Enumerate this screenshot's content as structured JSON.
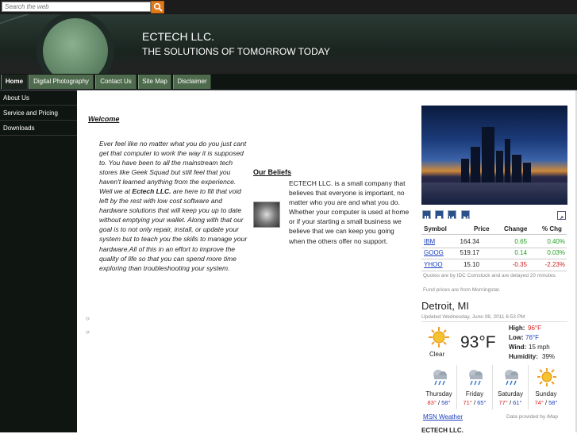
{
  "search": {
    "placeholder": "Search the web"
  },
  "header": {
    "title": "ECTECH LLC.",
    "tagline": "THE SOLUTIONS OF TOMORROW TODAY"
  },
  "nav": {
    "items": [
      "Home",
      "Digital Photography",
      "Contact Us",
      "Site Map",
      "Disclaimer"
    ]
  },
  "sidebar": {
    "items": [
      "About Us",
      "Service and Pricing",
      "Downloads"
    ]
  },
  "welcome": {
    "heading": "Welcome",
    "text_before": "Ever feel like no matter what you do you just cant get that computer to work the way it is supposed to.  You have been to all the mainstream tech stores like Geek Squad but still feel that you haven't learned anything from the experience.  Well we at ",
    "brand": "Ectech LLC.",
    "text_after": " are here to fill that void left by the rest with low cost software and hardware solutions that will keep you up to date without emptying your wallet. Along with that our goal is to not only repair, install, or update your system but to teach you the skills to manage your hardware.All of this in an effort to improve the quality of life so that you can spend more time exploring than troubleshooting your system."
  },
  "beliefs": {
    "heading": "Our Beliefs",
    "text": "ECTECH LLC. is a small company that believes that everyone is important, no matter who you are and what you do.  Whether your computer is used at home or if your starting a small business we believe that we can keep you going when the others offer no support."
  },
  "stocks": {
    "headers": {
      "symbol": "Symbol",
      "price": "Price",
      "change": "Change",
      "pct": "% Chg"
    },
    "rows": [
      {
        "symbol": "IBM",
        "price": "164.34",
        "change": "0.65",
        "pct": "0.40%",
        "dir": "up"
      },
      {
        "symbol": "GOOG",
        "price": "519.17",
        "change": "0.14",
        "pct": "0.03%",
        "dir": "up"
      },
      {
        "symbol": "YHOO",
        "price": "15.10",
        "change": "-0.35",
        "pct": "-2.23%",
        "dir": "down"
      }
    ],
    "note1": "Quotes are by IDC Comstock and are delayed 20 minutes.",
    "note2": "Fund prices are from Morningstar."
  },
  "weather": {
    "city": "Detroit, MI",
    "updated": "Updated Wednesday, June 08, 2011 6:53 PM",
    "condition": "Clear",
    "temp": "93°F",
    "high_label": "High:",
    "high": "96°F",
    "low_label": "Low:",
    "low": "76°F",
    "wind_label": "Wind:",
    "wind": "15 mph",
    "humidity_label": "Humidity:",
    "humidity": "39%",
    "forecast": [
      {
        "day": "Thursday",
        "hi": "83°",
        "lo": "58°",
        "icon": "rain-icon"
      },
      {
        "day": "Friday",
        "hi": "71°",
        "lo": "65°",
        "icon": "rain-icon"
      },
      {
        "day": "Saturday",
        "hi": "77°",
        "lo": "61°",
        "icon": "rain-icon"
      },
      {
        "day": "Sunday",
        "hi": "74°",
        "lo": "58°",
        "icon": "sun-icon"
      }
    ],
    "link": "MSN Weather",
    "provided": "Data provided by iMap"
  },
  "footer": {
    "title": "ECTECH LLC."
  },
  "colors": {
    "nav_green": "#4f6b4d",
    "dark": "#0f1511",
    "link": "#1a3fbf",
    "up": "#22a022",
    "down": "#d22222"
  }
}
